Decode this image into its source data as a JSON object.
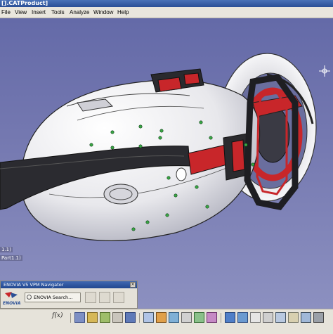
{
  "window": {
    "title": "[].CATProduct]"
  },
  "menu": {
    "items": [
      "File",
      "View",
      "Insert",
      "Tools",
      "Analyze",
      "Window",
      "Help"
    ]
  },
  "tree": {
    "fragments": [
      "1.1)",
      "Part1.1)"
    ]
  },
  "navigator": {
    "title": "ENOVIA V5 VPM Navigator",
    "logo_text": "ENOVIA",
    "search_label": "ENOVIA Search..."
  },
  "toolbar": {
    "formula_label": "f(x)"
  },
  "colors": {
    "background_top": "#646aa8",
    "background_bottom": "#8c90c0",
    "model_body": "#e8e8ec",
    "model_strap": "#2a2a2e",
    "model_accent": "#c8262a",
    "constraint_marker": "#3aa845"
  },
  "icons": [
    "compass-icon",
    "search-icon",
    "enovia-logo-icon",
    "formula-icon",
    "close-icon"
  ]
}
